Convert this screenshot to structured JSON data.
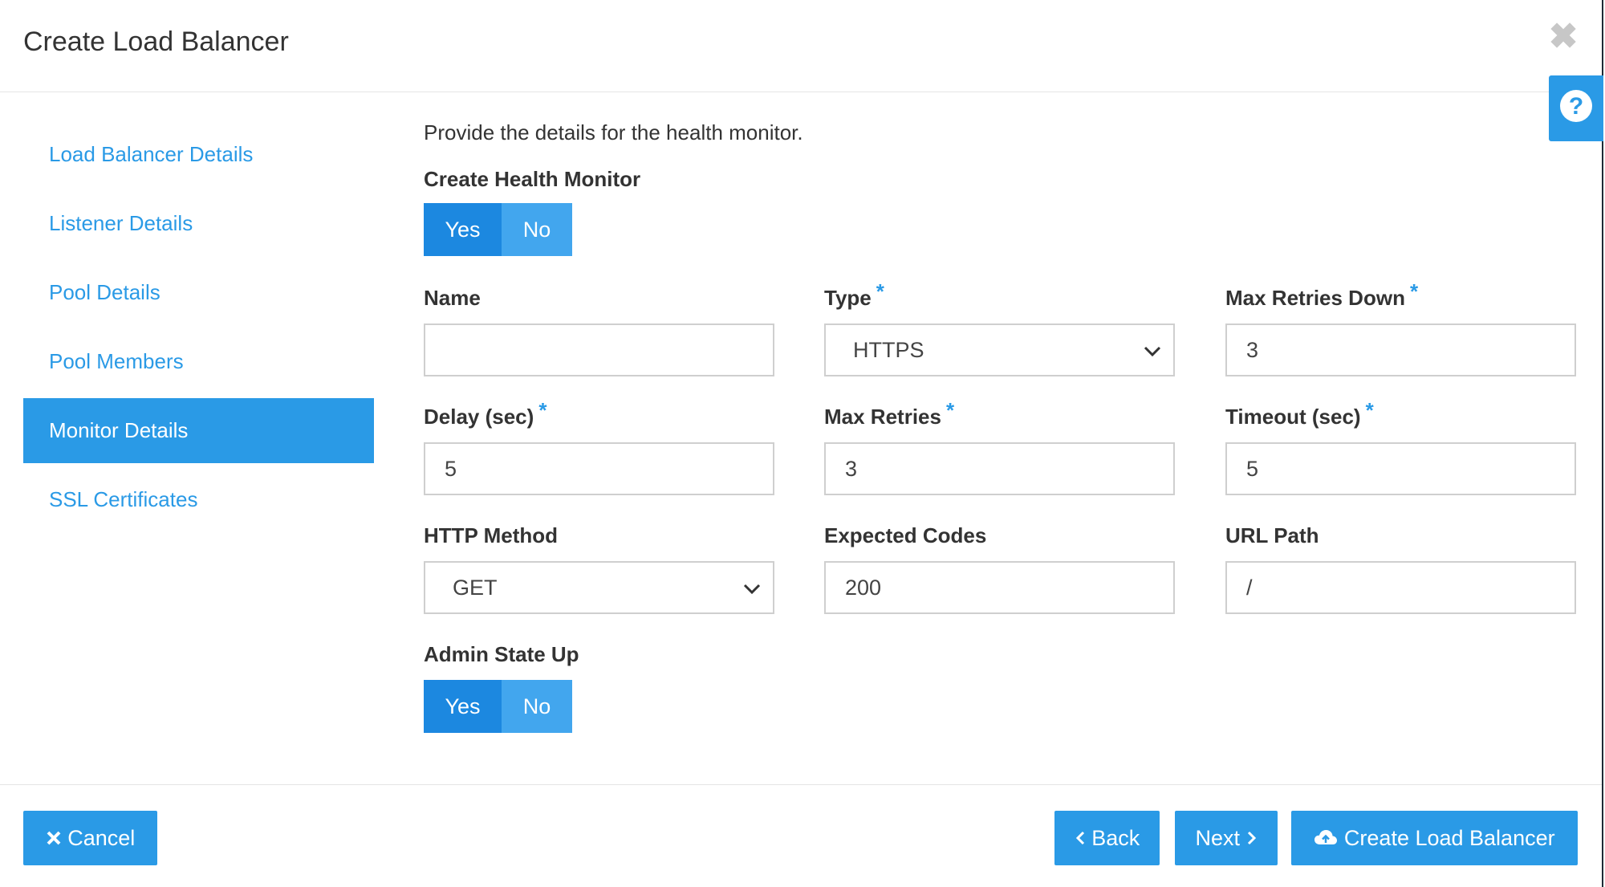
{
  "header": {
    "title": "Create Load Balancer",
    "close_glyph": "✖",
    "help_glyph": "?"
  },
  "sidebar": {
    "items": [
      {
        "label": "Load Balancer Details"
      },
      {
        "label": "Listener Details"
      },
      {
        "label": "Pool Details"
      },
      {
        "label": "Pool Members"
      },
      {
        "label": "Monitor Details",
        "active": true
      },
      {
        "label": "SSL Certificates"
      }
    ]
  },
  "main": {
    "intro": "Provide the details for the health monitor.",
    "create_health_monitor": {
      "label": "Create Health Monitor",
      "yes": "Yes",
      "no": "No",
      "selected": "Yes"
    },
    "fields": {
      "name": {
        "label": "Name",
        "value": ""
      },
      "type": {
        "label": "Type",
        "value": "HTTPS",
        "required": true
      },
      "max_retries_down": {
        "label": "Max Retries Down",
        "value": "3",
        "required": true
      },
      "delay": {
        "label": "Delay (sec)",
        "value": "5",
        "required": true
      },
      "max_retries": {
        "label": "Max Retries",
        "value": "3",
        "required": true
      },
      "timeout": {
        "label": "Timeout (sec)",
        "value": "5",
        "required": true
      },
      "http_method": {
        "label": "HTTP Method",
        "value": "GET"
      },
      "expected_codes": {
        "label": "Expected Codes",
        "value": "200"
      },
      "url_path": {
        "label": "URL Path",
        "value": "/"
      }
    },
    "required_marker": "*",
    "admin_state_up": {
      "label": "Admin State Up",
      "yes": "Yes",
      "no": "No",
      "selected": "Yes"
    }
  },
  "footer": {
    "cancel_label": "Cancel",
    "back_label": "Back",
    "next_label": "Next",
    "create_label": "Create Load Balancer"
  },
  "colors": {
    "accent": "#2a9ae6",
    "toggle_selected": "#1c88e0",
    "toggle_unselected": "#42a6ee",
    "close_icon": "#c7c7c7"
  },
  "icons": {
    "close": "close-icon",
    "help": "question-circle-icon",
    "cancel": "times-icon",
    "back": "chevron-left-icon",
    "next": "chevron-right-icon",
    "create": "cloud-upload-icon",
    "select": "chevron-down-icon"
  }
}
